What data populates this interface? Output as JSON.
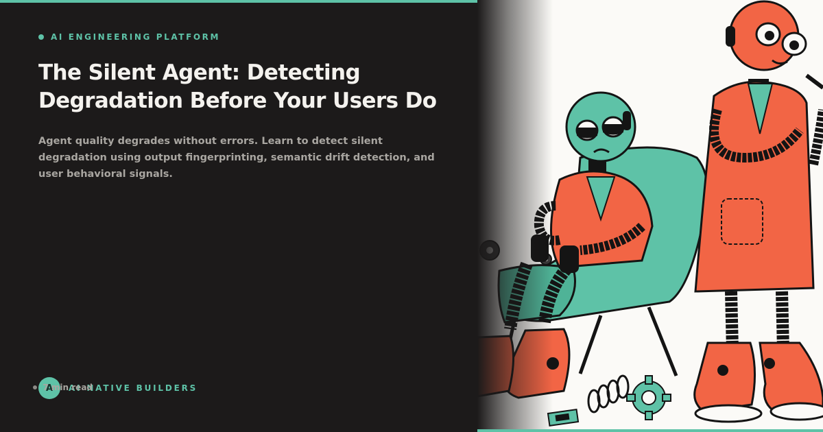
{
  "header": {
    "kicker": "AI ENGINEERING PLATFORM",
    "title": "The Silent Agent: Detecting Degradation Before Your Users Do",
    "summary": "Agent quality degrades without errors. Learn to detect silent degradation using output fingerprinting, semantic drift detection, and user behavioral signals."
  },
  "footer": {
    "avatar_letter": "A",
    "brand": "AI NATIVE BUILDERS",
    "read_time": "7 min read"
  },
  "colors": {
    "background": "#1c1a1a",
    "accent": "#5ec2a7",
    "robot_orange": "#f26545",
    "robot_teal": "#5ec2a7",
    "illustration_bg": "#fbfaf7"
  },
  "illustration": {
    "icons": [
      "robot-sitting-sad",
      "robot-standing-doctor",
      "armchair",
      "gear-icon",
      "spring",
      "chip-icon"
    ]
  }
}
